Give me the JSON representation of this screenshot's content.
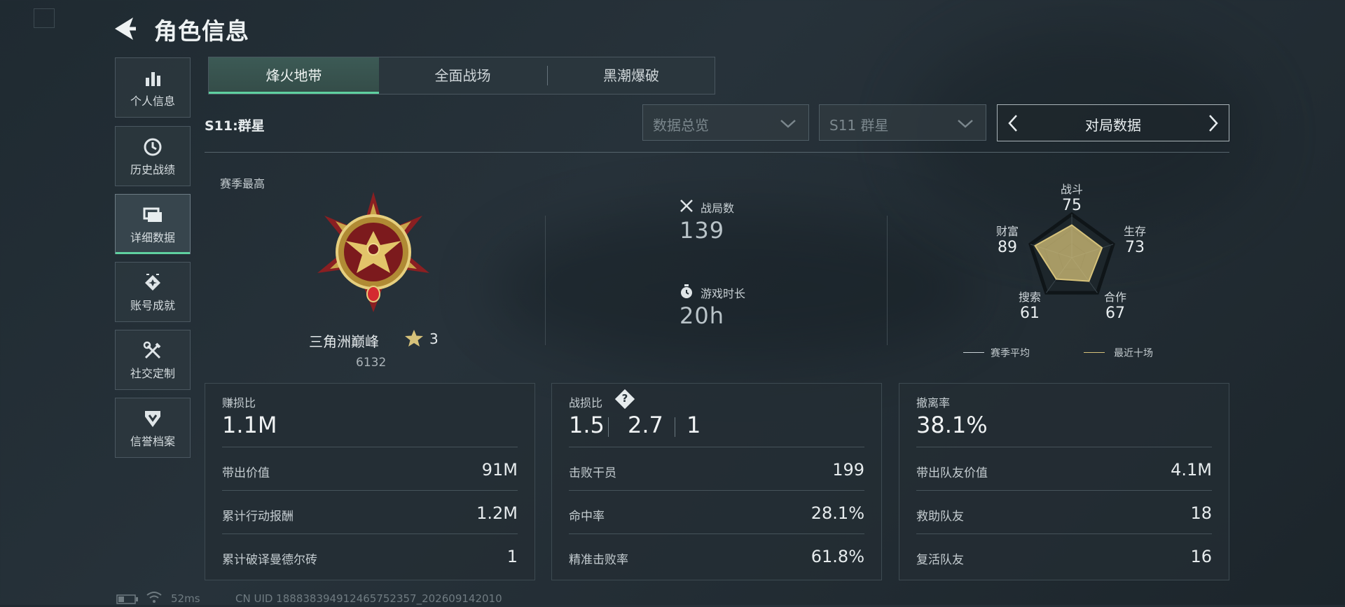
{
  "header": {
    "title": "角色信息"
  },
  "sidebar": {
    "items": [
      {
        "label": "个人信息",
        "icon": "bar-chart-icon"
      },
      {
        "label": "历史战绩",
        "icon": "clock-icon"
      },
      {
        "label": "详细数据",
        "icon": "cards-icon",
        "active": true
      },
      {
        "label": "账号成就",
        "icon": "achievement-icon"
      },
      {
        "label": "社交定制",
        "icon": "tools-icon"
      },
      {
        "label": "信誉档案",
        "icon": "shield-icon"
      }
    ]
  },
  "tabs": [
    {
      "label": "烽火地带",
      "active": true
    },
    {
      "label": "全面战场"
    },
    {
      "label": "黑潮爆破"
    }
  ],
  "filters": {
    "season_label": "S11:群星",
    "dropdown1": "数据总览",
    "dropdown2": "S11 群星",
    "pager": "对局数据"
  },
  "rank": {
    "label": "赛季最高",
    "name": "三角洲巅峰",
    "stars": "3",
    "score": "6132"
  },
  "summary": {
    "matches_label": "战局数",
    "matches": "139",
    "playtime_label": "游戏时长",
    "playtime": "20h"
  },
  "radar": {
    "axes": [
      {
        "label": "战斗",
        "value": 75
      },
      {
        "label": "生存",
        "value": 73
      },
      {
        "label": "合作",
        "value": 67
      },
      {
        "label": "搜索",
        "value": 61
      },
      {
        "label": "财富",
        "value": 89
      }
    ],
    "legend": [
      {
        "label": "赛季平均",
        "color": "#c9d1d5"
      },
      {
        "label": "最近十场",
        "color": "#d6c27a"
      }
    ]
  },
  "cards": [
    {
      "title": "赚损比",
      "big": "1.1M",
      "rows": [
        {
          "label": "带出价值",
          "value": "91M"
        },
        {
          "label": "累计行动报酬",
          "value": "1.2M"
        },
        {
          "label": "累计破译曼德尔砖",
          "value": "1"
        }
      ]
    },
    {
      "title": "战损比",
      "big_parts": [
        "1.5",
        "2.7",
        "1"
      ],
      "help": "?",
      "rows": [
        {
          "label": "击败干员",
          "value": "199"
        },
        {
          "label": "命中率",
          "value": "28.1%"
        },
        {
          "label": "精准击败率",
          "value": "61.8%"
        }
      ]
    },
    {
      "title": "撤离率",
      "big": "38.1%",
      "rows": [
        {
          "label": "带出队友价值",
          "value": "4.1M"
        },
        {
          "label": "救助队友",
          "value": "18"
        },
        {
          "label": "复活队友",
          "value": "16"
        }
      ]
    }
  ],
  "footer": {
    "ping": "52ms",
    "uid": "CN UID 188838394912465752357_202609142010"
  },
  "colors": {
    "accent": "#5fd0a0",
    "gold": "#d6c27a"
  }
}
